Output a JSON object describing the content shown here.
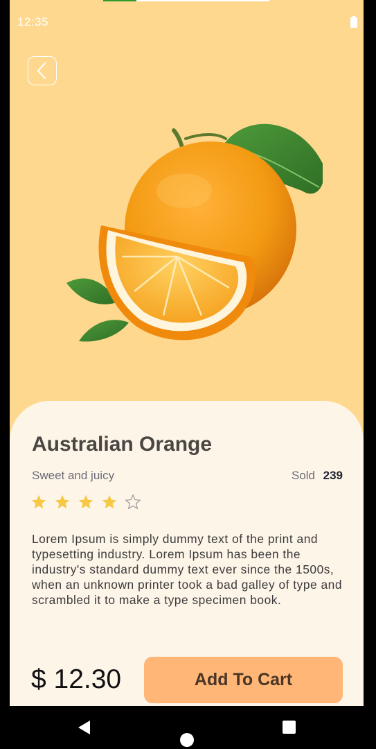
{
  "status_bar": {
    "time": "12:35"
  },
  "loading_progress": 0.2,
  "product": {
    "name": "Australian Orange",
    "subtitle": "Sweet and juicy",
    "sold_label": "Sold",
    "sold_count": "239",
    "rating": 4,
    "rating_max": 5,
    "description": "Lorem Ipsum is simply dummy text of the print and typesetting industry. Lorem Ipsum has been the industry's standard dummy text ever since the 1500s, when an unknown printer took a bad galley of type and scrambled it to make a type specimen book.",
    "price": "$ 12.30"
  },
  "actions": {
    "add_to_cart": "Add To Cart"
  },
  "icons": {
    "back": "chevron-left-icon",
    "star_filled": "star-filled-icon",
    "star_empty": "star-outline-icon",
    "nav_back": "triangle-back-icon",
    "nav_home": "circle-home-icon",
    "nav_recent": "square-recent-icon"
  },
  "colors": {
    "header_background": "#FFD88F",
    "sheet_background": "#FEF5E9",
    "button": "#FFB676",
    "star": "#F7C843"
  }
}
